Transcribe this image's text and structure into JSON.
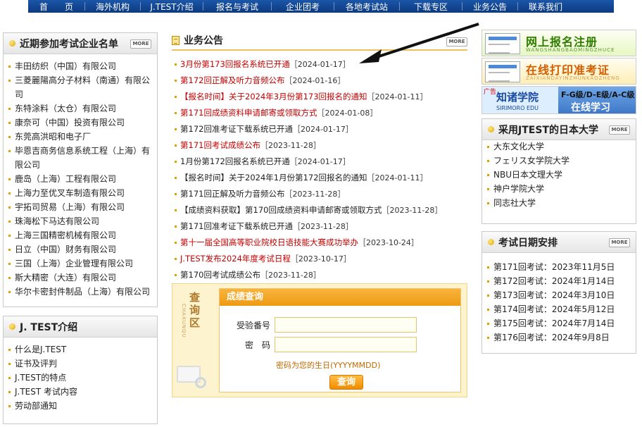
{
  "nav": [
    "首　　页",
    "海外机构",
    "J.TEST介绍",
    "报名与考试",
    "企业团考",
    "各地考试站",
    "下载专区",
    "业务公告",
    "联系我们"
  ],
  "more_label": "MORE",
  "companies": {
    "title": "近期参加考试企业名单",
    "items": [
      "丰田纺织（中国）有限公司",
      "三菱麗陽高分子材料（南通）有限公司",
      "东特涂料（太仓）有限公司",
      "康奈可（中国）投资有限公司",
      "东莞高洪昭和电子厂",
      "毕恩吉商务信息系统工程（上海）有限公司",
      "鹿岛（上海）工程有限公司",
      "上海力至优叉车制造有限公司",
      "宇拓司贸易（上海）有限公司",
      "珠海松下马达有限公司",
      "上海三国精密机械有限公司",
      "日立（中国）财务有限公司",
      "三国（上海）企业管理有限公司",
      "斯大精密（大连）有限公司",
      "华尔卡密封件制品（上海）有限公司"
    ]
  },
  "jtest": {
    "title": "J. TEST介绍",
    "items": [
      "什么是J.TEST",
      "证书及评判",
      "J.TEST的特点",
      "J.TEST 考试内容",
      "劳动部通知"
    ]
  },
  "announcements": {
    "title": "业务公告",
    "items": [
      {
        "text": "3月份第173回报名系统已开通",
        "date": "［2024-01-17］",
        "red": true
      },
      {
        "text": "第172回正解及听力音频公布",
        "date": "［2024-01-16］",
        "red": true
      },
      {
        "text": "【报名时间】关于2024年3月份第173回报名的通知",
        "date": "［2024-01-11］",
        "red": true
      },
      {
        "text": "第171回成绩资料申请邮寄或领取方式",
        "date": "［2024-01-08］",
        "red": true
      },
      {
        "text": "第172回准考证下载系统已开通",
        "date": "［2024-01-17］",
        "red": false
      },
      {
        "text": "第171回考试成绩公布",
        "date": "［2023-11-28］",
        "red": true
      },
      {
        "text": "1月份第172回报名系统已开通",
        "date": "［2024-01-17］",
        "red": false
      },
      {
        "text": "【报名时间】关于2024年1月份第172回报名的通知",
        "date": "［2024-01-11］",
        "red": false
      },
      {
        "text": "第171回正解及听力音频公布",
        "date": "［2023-11-28］",
        "red": false
      },
      {
        "text": "【成绩资料获取】第170回成绩资料申请邮寄或领取方式",
        "date": "［2023-11-28］",
        "red": false
      },
      {
        "text": "第171回准考证下载系统已开通",
        "date": "［2023-11-28］",
        "red": false
      },
      {
        "text": "第十一届全国高等职业院校日语技能大赛成功举办",
        "date": "［2023-10-24］",
        "red": true
      },
      {
        "text": "J.TEST发布2024年度考试日程",
        "date": "［2023-10-17］",
        "red": true
      },
      {
        "text": "第170回考试成绩公布",
        "date": "［2023-11-28］",
        "red": false
      }
    ]
  },
  "query": {
    "side_title": "查询区",
    "side_pinyin": "CHAXUNQU",
    "header": "成绩查询",
    "exam_number_label": "受验番号",
    "password_label": "密　码",
    "exam_number_value": "",
    "password_value": "",
    "hint": "密码为您的生日(YYYYMMDD)",
    "button": "查询"
  },
  "banners": {
    "register": {
      "text": "网上报名注册",
      "sub": "WANGSHANGBAOMINGZHUCE"
    },
    "print": {
      "text": "在线打印准考证",
      "sub": "ZAIXIANDAYINZHUNKAOZHENG"
    },
    "school": {
      "ad": "广告",
      "name": "知诸学院",
      "en": "SIRIMORO EDU",
      "line1": "F-G级/D-E级/A-C级",
      "line2": "在线学习"
    }
  },
  "universities": {
    "title": "采用JTEST的日本大学",
    "items": [
      "大东文化大学",
      "フェリス女学院大学",
      "NBU日本文理大学",
      "神户学院大学",
      "同志社大学"
    ]
  },
  "schedule": {
    "title": "考试日期安排",
    "items": [
      "第171回考试：2023年11月5日",
      "第172回考试：2024年1月14日",
      "第173回考试：2024年3月10日",
      "第174回考试：2024年5月12日",
      "第175回考试：2024年7月14日",
      "第176回考试：2024年9月8日"
    ]
  },
  "colors": {
    "nav_blue": "#0d3a80",
    "accent_orange": "#ef8c00",
    "announcement_red": "#c40000"
  }
}
